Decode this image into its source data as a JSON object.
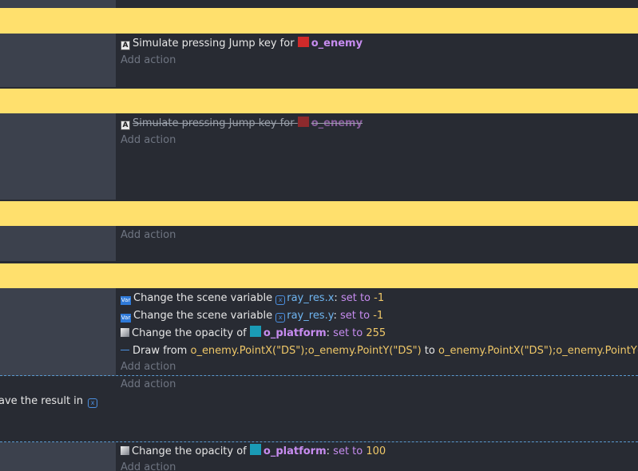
{
  "events": {
    "e1": {
      "action_label": "Simulate pressing Jump key for",
      "object": "o_enemy",
      "add_action": "Add action"
    },
    "e2": {
      "action_label": "Simulate pressing Jump key for",
      "object": "o_enemy",
      "add_action": "Add action",
      "disabled": true
    },
    "e3": {
      "add_action": "Add action"
    },
    "e4": {
      "a1_label": "Change the scene variable",
      "a1_var": "ray_res.x",
      "a1_colon": ":",
      "a1_op": "set to",
      "a1_value": "-1",
      "a2_label": "Change the scene variable",
      "a2_var": "ray_res.y",
      "a2_colon": ":",
      "a2_op": "set to",
      "a2_value": "-1",
      "a3_label": "Change the opacity of",
      "a3_object": "o_platform",
      "a3_colon": ":",
      "a3_op": "set to",
      "a3_value": "255",
      "a4_label": "Draw from",
      "a4_from": "o_enemy.PointX(\"DS\");o_enemy.PointY(\"DS\")",
      "a4_to_word": "to",
      "a4_to": "o_enemy.PointX(\"DS\");o_enemy.PointY(\"DS",
      "add_action": "Add action"
    },
    "e5": {
      "condition_partial": "ave the result in",
      "add_action": "Add action"
    },
    "e6": {
      "a1_label": "Change the opacity of",
      "a1_object": "o_platform",
      "a1_colon": ":",
      "a1_op": "set to",
      "a1_value": "100",
      "add_action": "Add action"
    }
  },
  "colors": {
    "separator": "#ffe06d",
    "condition_bg": "#3c414d",
    "action_bg": "#282b33",
    "object_name": "#c78cf0",
    "variable": "#6fb6f2",
    "number": "#f0c868"
  },
  "icons": {
    "key": "keyboard-key-icon",
    "enemy": "o-enemy-sprite-icon",
    "platform": "o-platform-sprite-icon",
    "variable": "scene-variable-icon",
    "opacity": "opacity-icon",
    "draw": "draw-line-icon"
  }
}
